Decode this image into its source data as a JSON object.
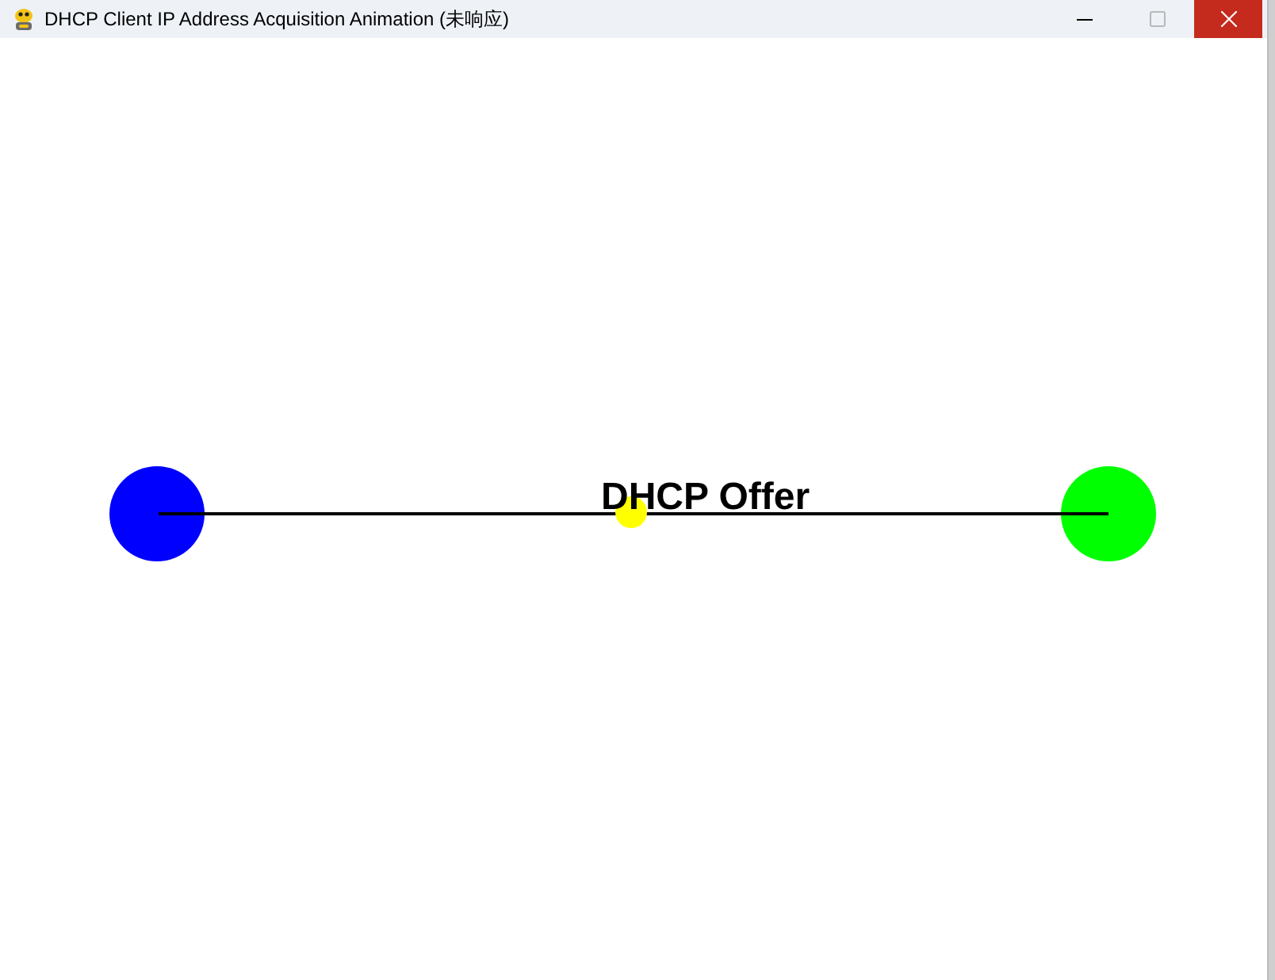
{
  "window": {
    "title": "DHCP Client IP Address Acquisition Animation (未响应)"
  },
  "nodes": [
    {
      "color": "#0000ff"
    },
    {
      "color": "#00ff00"
    }
  ],
  "packet": {
    "label": "DHCP Offer"
  }
}
